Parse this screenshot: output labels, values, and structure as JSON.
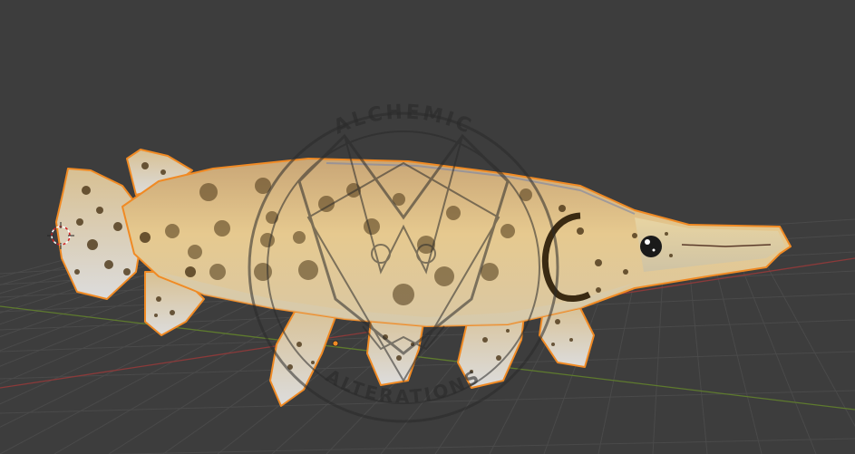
{
  "viewport": {
    "background": "#3d3d3d",
    "grid_color": "#4a4a4a",
    "x_axis_color": "#8a3a3a",
    "y_axis_color": "#5e7a2e",
    "selection_outline_color": "#f08a24"
  },
  "model": {
    "name": "spotted-gar",
    "body_color": "#e2c48c",
    "spot_color": "#4a3416"
  },
  "icons": {
    "origin": "3d-cursor-icon",
    "object_origin": "object-origin-dot"
  },
  "watermark": {
    "top_text": "ALCHEMIC",
    "bottom_text": "ALTERATIONS",
    "color": "#2a2a2a"
  }
}
